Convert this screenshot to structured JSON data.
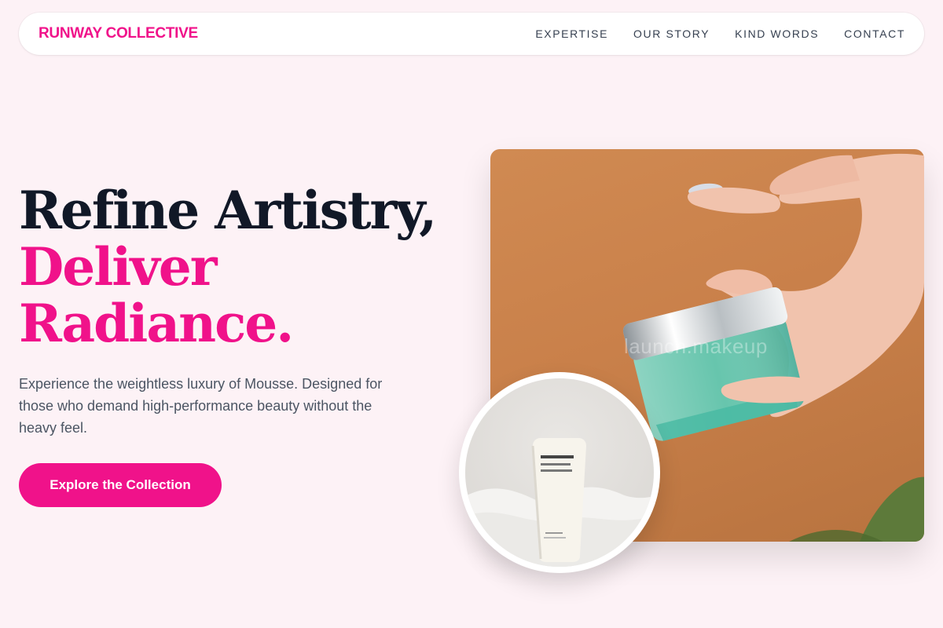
{
  "header": {
    "brand": "RUNWAY COLLECTIVE",
    "nav": [
      {
        "label": "EXPERTISE"
      },
      {
        "label": "OUR STORY"
      },
      {
        "label": "KIND WORDS"
      },
      {
        "label": "CONTACT"
      }
    ]
  },
  "hero": {
    "title_line1": "Refine Artistry,",
    "title_line2": "Deliver",
    "title_line3": "Radiance.",
    "description": "Experience the weightless luxury of Mousse. Designed for those who demand high-performance beauty without the heavy feel.",
    "cta_label": "Explore the Collection"
  },
  "media": {
    "main_image_watermark": "launch.makeup",
    "tube_brand": "Nécessaire",
    "tube_line1": "The Body Lotion",
    "tube_line2": "L'Émulsion Corps"
  },
  "colors": {
    "accent": "#f0128a",
    "background": "#fdf2f6",
    "heading": "#111827",
    "body_text": "#4b5563"
  }
}
